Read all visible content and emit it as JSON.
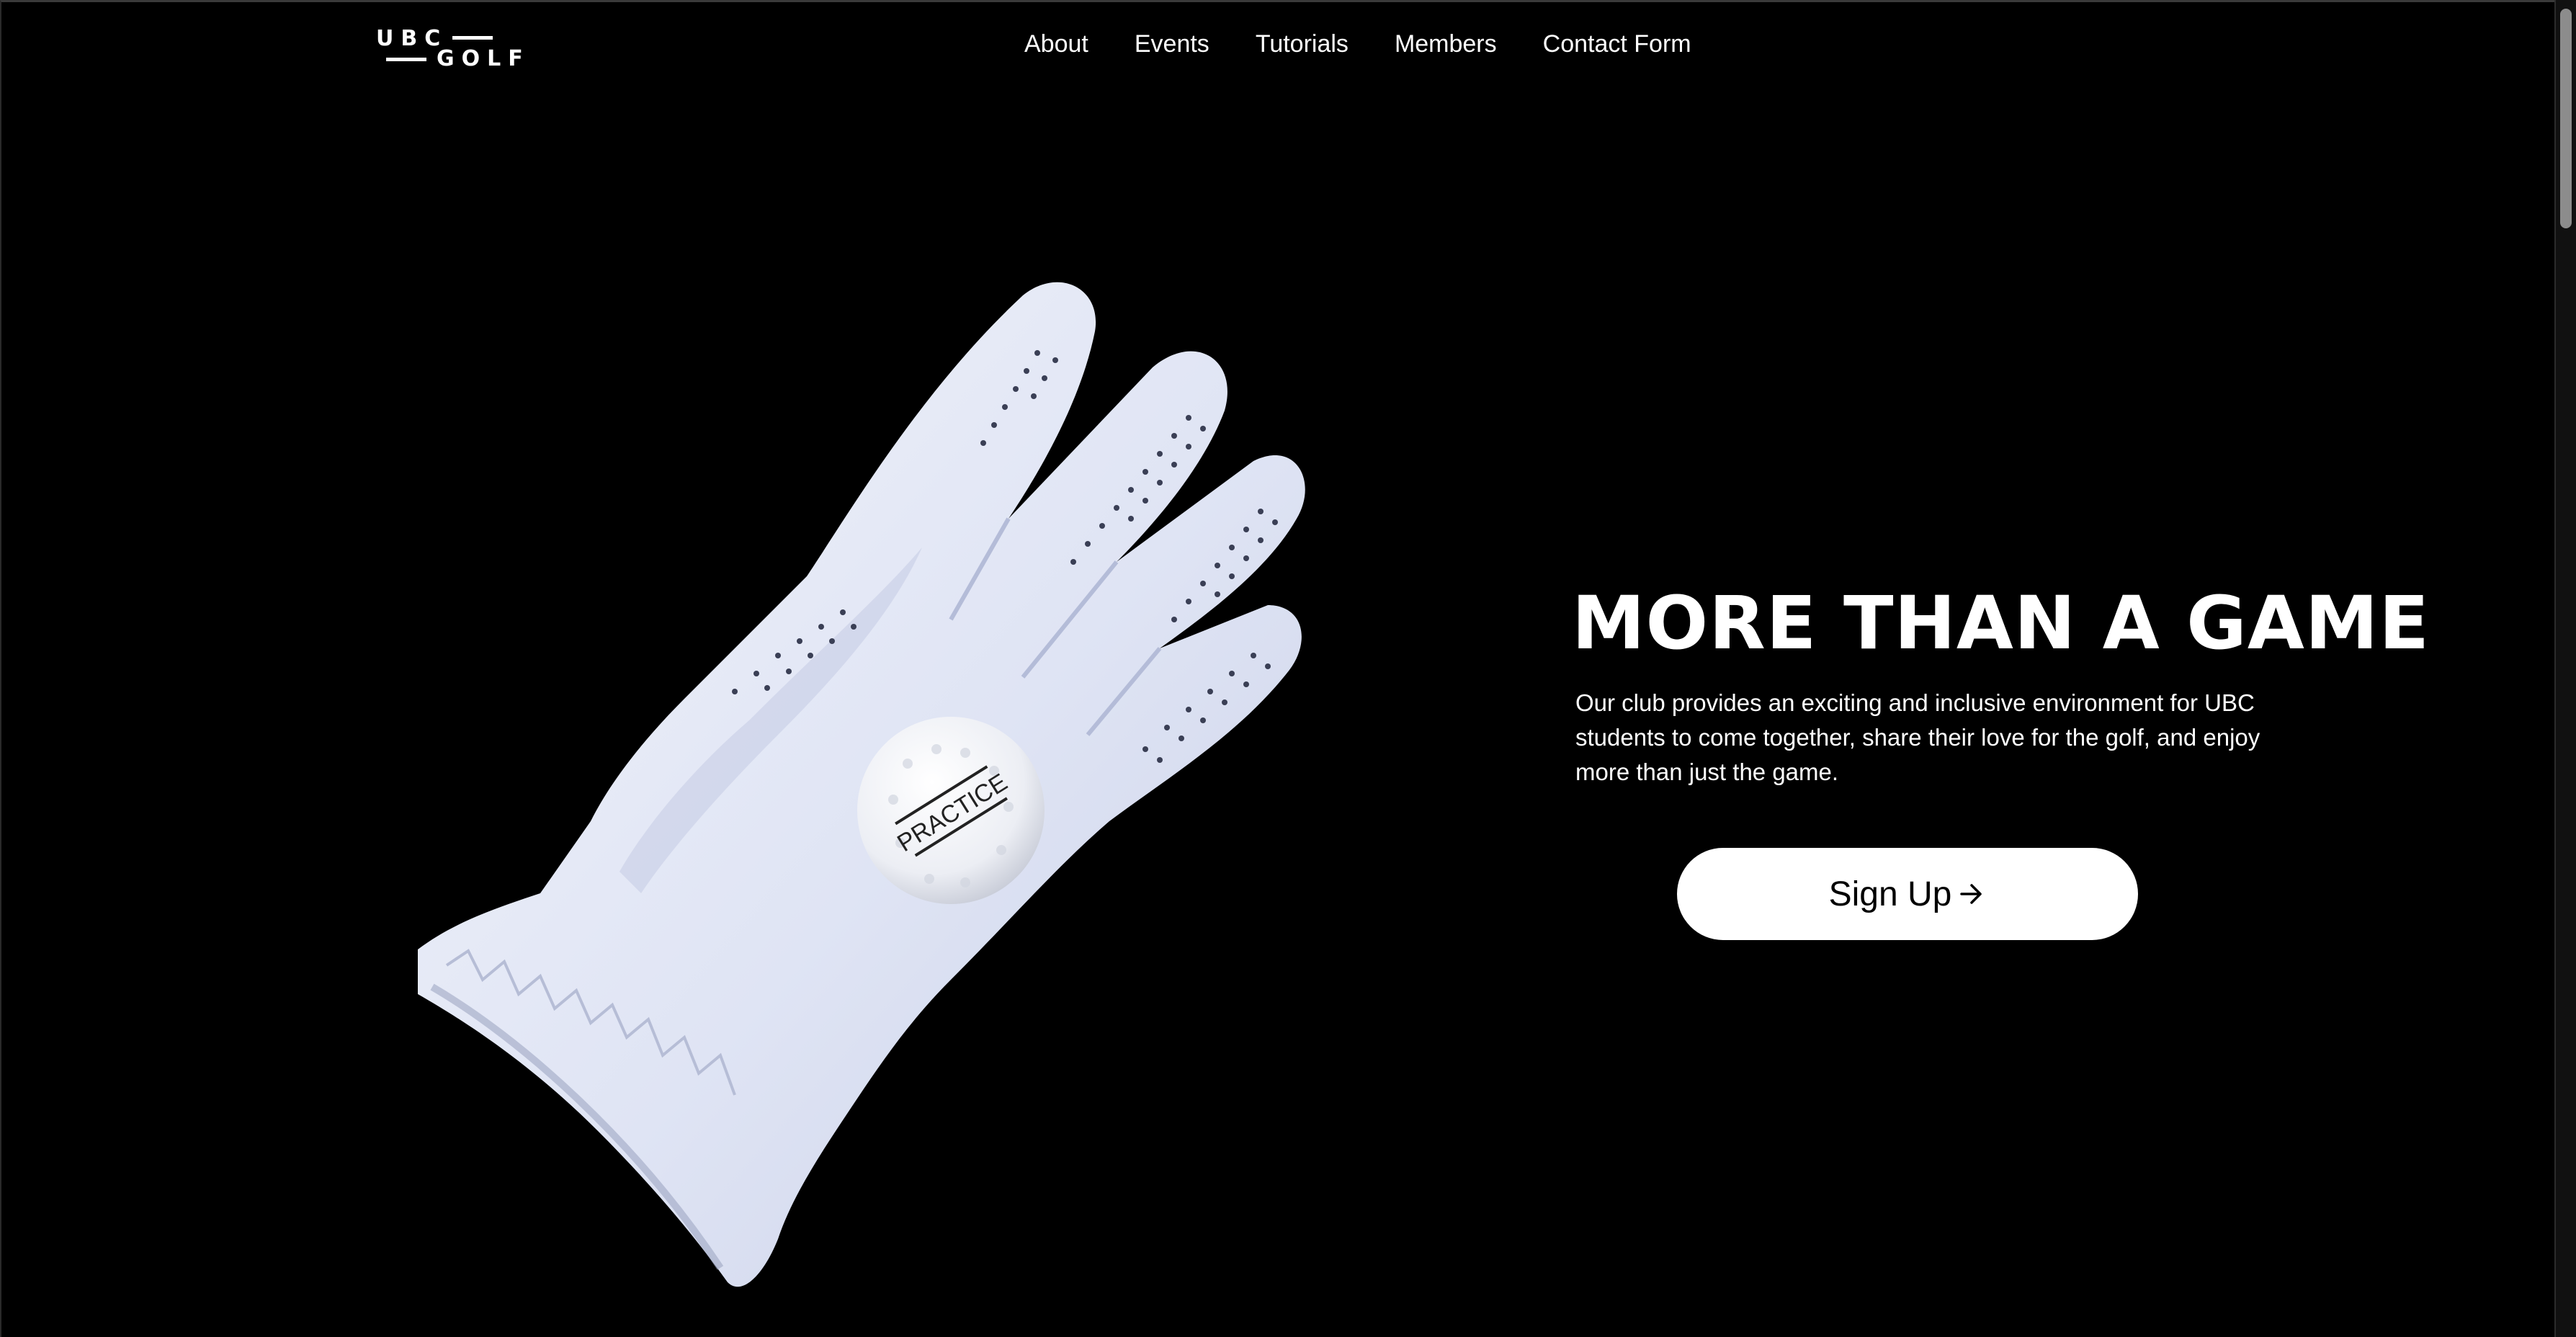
{
  "header": {
    "logo": {
      "line1": "UBC",
      "line2": "GOLF"
    },
    "nav": [
      {
        "label": "About"
      },
      {
        "label": "Events"
      },
      {
        "label": "Tutorials"
      },
      {
        "label": "Members"
      },
      {
        "label": "Contact Form"
      }
    ]
  },
  "hero": {
    "title": "MORE THAN A GAME",
    "description": "Our club provides an exciting and inclusive environment for UBC students to come together, share their love for the golf, and enjoy more than just the game.",
    "cta_label": "Sign Up",
    "cta_icon": "arrow-right-icon",
    "image": {
      "subject": "golf-glove-with-ball-icon",
      "ball_text": "PRACTICE"
    }
  },
  "colors": {
    "background": "#000000",
    "text": "#ffffff",
    "button_bg": "#ffffff",
    "button_text": "#000000",
    "glove": "#e4e8f6"
  }
}
